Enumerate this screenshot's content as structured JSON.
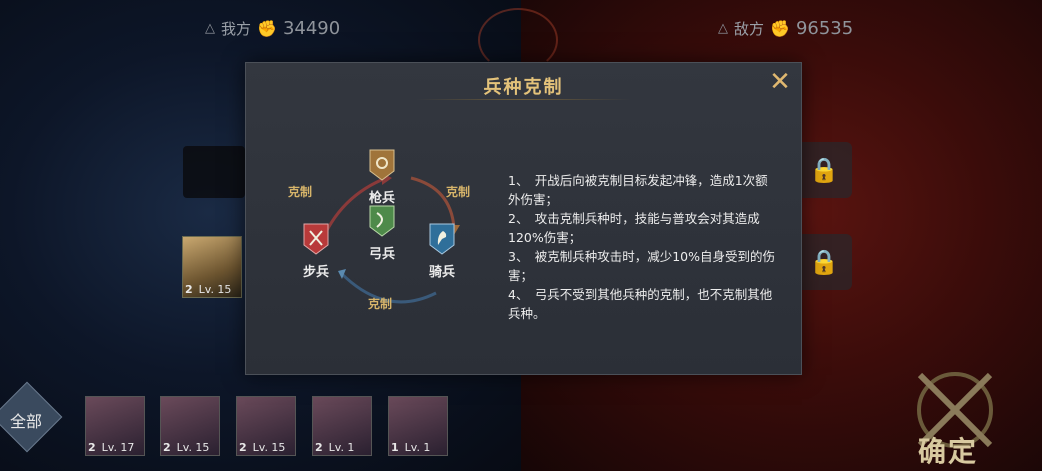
{
  "hud": {
    "ally_label": "我方",
    "ally_power": "34490",
    "enemy_label": "敌方",
    "enemy_power": "96535"
  },
  "side_hero": {
    "stars": "2",
    "level": "Lv. 15"
  },
  "bottom": {
    "all_label": "全部",
    "confirm_label": "确定",
    "heroes": [
      {
        "stars": "2",
        "level": "Lv. 17"
      },
      {
        "stars": "2",
        "level": "Lv. 15"
      },
      {
        "stars": "2",
        "level": "Lv. 15"
      },
      {
        "stars": "2",
        "level": "Lv. 1"
      },
      {
        "stars": "1",
        "level": "Lv. 1"
      }
    ]
  },
  "dialog": {
    "title": "兵种克制",
    "units": {
      "spear": "枪兵",
      "archer": "弓兵",
      "infantry": "步兵",
      "cavalry": "骑兵"
    },
    "counter_labels": {
      "left": "克制",
      "right": "克制",
      "bottom": "克制"
    },
    "rules": [
      "1、　开战后向被克制目标发起冲锋，造成1次额外伤害；",
      "2、　攻击克制兵种时，技能与普攻会对其造成120%伤害；",
      "3、　被克制兵种攻击时，减少10%自身受到的伤害；",
      "4、　弓兵不受到其他兵种的克制，也不克制其他兵种。"
    ]
  },
  "colors": {
    "accent_gold": "#e3c27a",
    "spear_shield": "#a0743a",
    "archer_shield": "#4e8a4a",
    "infantry_shield": "#b83a3a",
    "cavalry_shield": "#2f6f9a"
  }
}
